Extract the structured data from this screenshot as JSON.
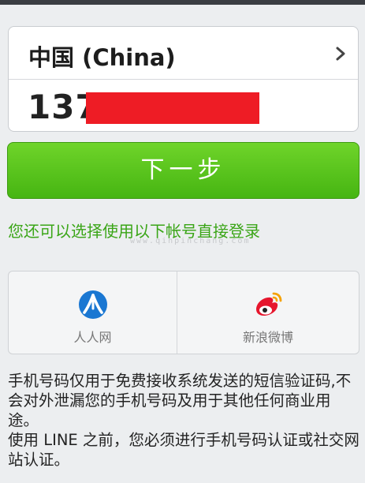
{
  "phone_form": {
    "country": "中国 (China)",
    "phone_prefix": "137"
  },
  "next_button_label": "下一步",
  "social_login": {
    "hint": "您还可以选择使用以下帐号直接登录",
    "watermark": "www.qinpinchang.com",
    "options": [
      {
        "label": "人人网",
        "icon": "renren-icon",
        "color": "#1a77d2"
      },
      {
        "label": "新浪微博",
        "icon": "weibo-icon",
        "color": "#e6162d"
      }
    ]
  },
  "disclaimer": {
    "line1": "手机号码仅用于免费接收系统发送的短信验证码,不会对外泄漏您的手机号码及用于其他任何商业用途。",
    "line2": "使用 LINE 之前，您必须进行手机号码认证或社交网站认证。"
  },
  "colors": {
    "accent_green": "#46b512",
    "hint_green": "#3aa517",
    "redaction": "#ee1c25"
  }
}
